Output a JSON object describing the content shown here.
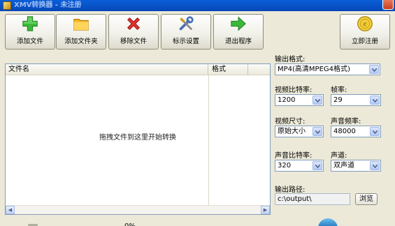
{
  "window": {
    "title": "XMV转换器 - 未注册"
  },
  "toolbar": {
    "add_file": "添加文件",
    "add_folder": "添加文件夹",
    "remove_file": "移除文件",
    "show_settings": "标示设置",
    "exit_program": "退出程序",
    "register_now": "立即注册"
  },
  "filelist": {
    "col_name": "文件名",
    "col_format": "格式",
    "drop_hint": "拖拽文件到这里开始转换"
  },
  "settings": {
    "output_format_label": "输出格式:",
    "output_format_value": "MP4(高清MPEG4格式)",
    "video_bitrate_label": "视频比特率:",
    "video_bitrate_value": "1200",
    "frame_rate_label": "帧率:",
    "frame_rate_value": "29",
    "video_size_label": "视频尺寸:",
    "video_size_value": "原始大小",
    "audio_sample_rate_label": "声音频率:",
    "audio_sample_rate_value": "48000",
    "audio_bitrate_label": "声音比特率:",
    "audio_bitrate_value": "320",
    "audio_channels_label": "声道:",
    "audio_channels_value": "双声道",
    "output_path_label": "输出路径:",
    "output_path_value": "c:\\output\\",
    "browse_label": "浏览"
  },
  "status": {
    "progress_text": "0%"
  },
  "icons": {
    "add_file": "plus-icon",
    "add_folder": "folder-icon",
    "remove_file": "x-icon",
    "show_settings": "wrench-screwdriver-icon",
    "exit_program": "arrow-right-icon",
    "register_now": "coin-icon"
  },
  "colors": {
    "window_bg": "#ece9d8",
    "titlebar": "#0a5fd8",
    "input_border": "#7f9db9"
  }
}
